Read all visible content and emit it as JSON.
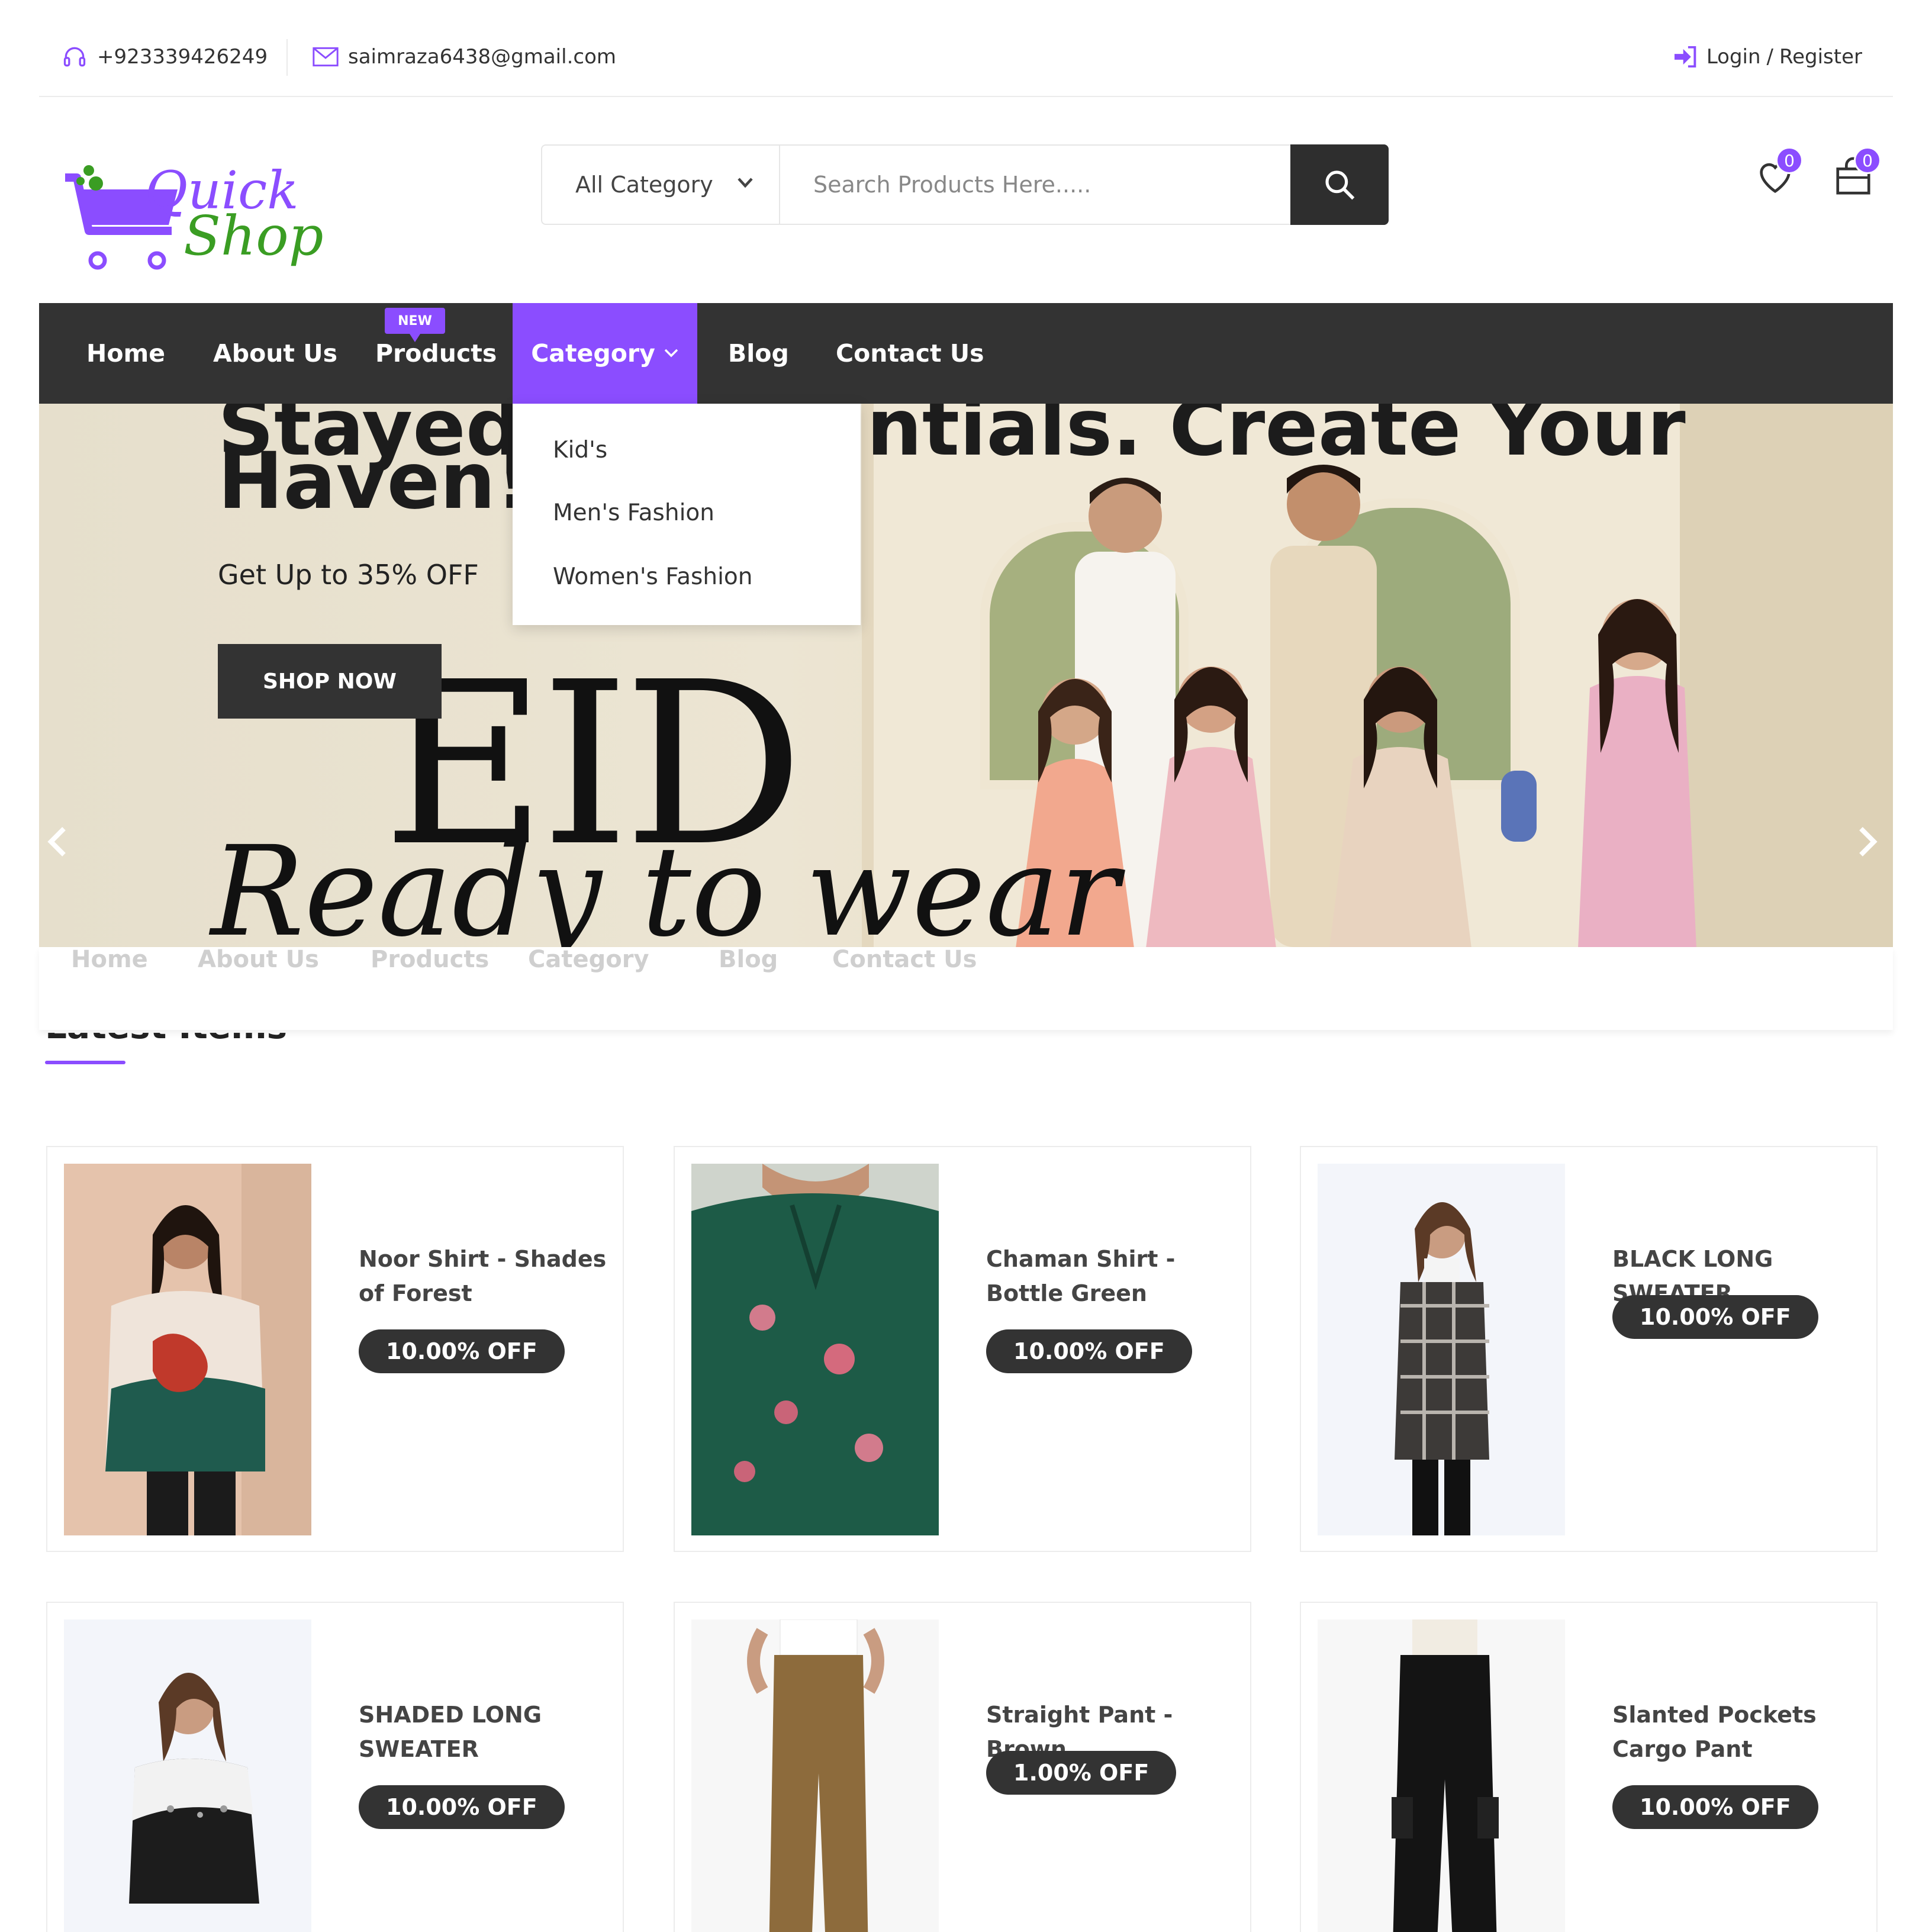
{
  "topbar": {
    "phone": "+923339426249",
    "email": "saimraza6438@gmail.com",
    "login": "Login",
    "register": "Register"
  },
  "logo": {
    "word1": "Quick",
    "word2": "Shop"
  },
  "search": {
    "category": "All Category",
    "placeholder": "Search Products Here....."
  },
  "header": {
    "wishlist_count": "0",
    "cart_count": "0"
  },
  "nav": {
    "home": "Home",
    "about": "About Us",
    "products": "Products",
    "products_badge": "NEW",
    "category": "Category",
    "blog": "Blog",
    "contact": "Contact Us"
  },
  "dropdown": [
    "Kid's",
    "Men's Fashion",
    "Women's Fashion"
  ],
  "hero": {
    "title_top_left": "Stayed",
    "title_top_right": "ntials. Create Your",
    "title": "Haven!",
    "subtitle": "Get Up to 35% OFF",
    "button": "SHOP NOW",
    "eid": "EID",
    "script": "Ready to wear"
  },
  "ghost_nav": [
    "Home",
    "About Us",
    "Products",
    "Category",
    "Blog",
    "Contact Us"
  ],
  "section": {
    "title": "Latest Items"
  },
  "products": [
    {
      "name": "Noor Shirt - Shades of Forest",
      "discount": "10.00% OFF"
    },
    {
      "name": "Chaman Shirt - Bottle Green",
      "discount": "10.00% OFF"
    },
    {
      "name": "BLACK LONG SWEATER",
      "discount": "10.00% OFF"
    },
    {
      "name": "SHADED LONG SWEATER",
      "discount": "10.00% OFF"
    },
    {
      "name": "Straight Pant - Brown",
      "discount": "1.00% OFF"
    },
    {
      "name": "Slanted Pockets Cargo Pant",
      "discount": "10.00% OFF"
    }
  ],
  "colors": {
    "accent": "#8b4dff",
    "dark": "#333333",
    "logo_green": "#3a9d23"
  }
}
